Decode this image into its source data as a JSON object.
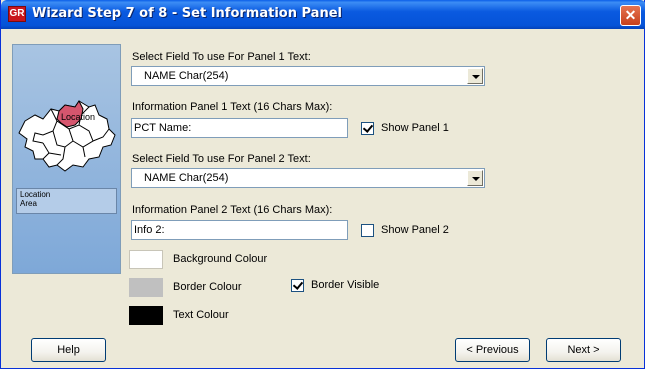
{
  "window": {
    "title": "Wizard Step 7 of 8 - Set Information Panel",
    "app_icon_text": "GR",
    "close_glyph": "✕"
  },
  "side_panel": {
    "map_label": "Location",
    "legend_line1": "Location",
    "legend_line2": "Area",
    "highlight_color": "#d6566e"
  },
  "panel1": {
    "field_label": "Select Field To use For Panel 1 Text:",
    "field_value": "NAME Char(254)",
    "text_label": "Information Panel 1 Text (16 Chars Max):",
    "text_value": "PCT Name:",
    "show_label": "Show Panel 1",
    "show_checked": true
  },
  "panel2": {
    "field_label": "Select Field To use For Panel 2 Text:",
    "field_value": "NAME Char(254)",
    "text_label": "Information Panel 2 Text (16 Chars Max):",
    "text_value": "Info 2:",
    "show_label": "Show Panel 2",
    "show_checked": false
  },
  "colours": {
    "background_label": "Background Colour",
    "background_color": "#ffffff",
    "border_label": "Border Colour",
    "border_color": "#c0c0c0",
    "text_label": "Text Colour",
    "text_color": "#000000",
    "border_visible_label": "Border Visible",
    "border_visible_checked": true
  },
  "buttons": {
    "help": "Help",
    "previous": "< Previous",
    "next": "Next >"
  }
}
